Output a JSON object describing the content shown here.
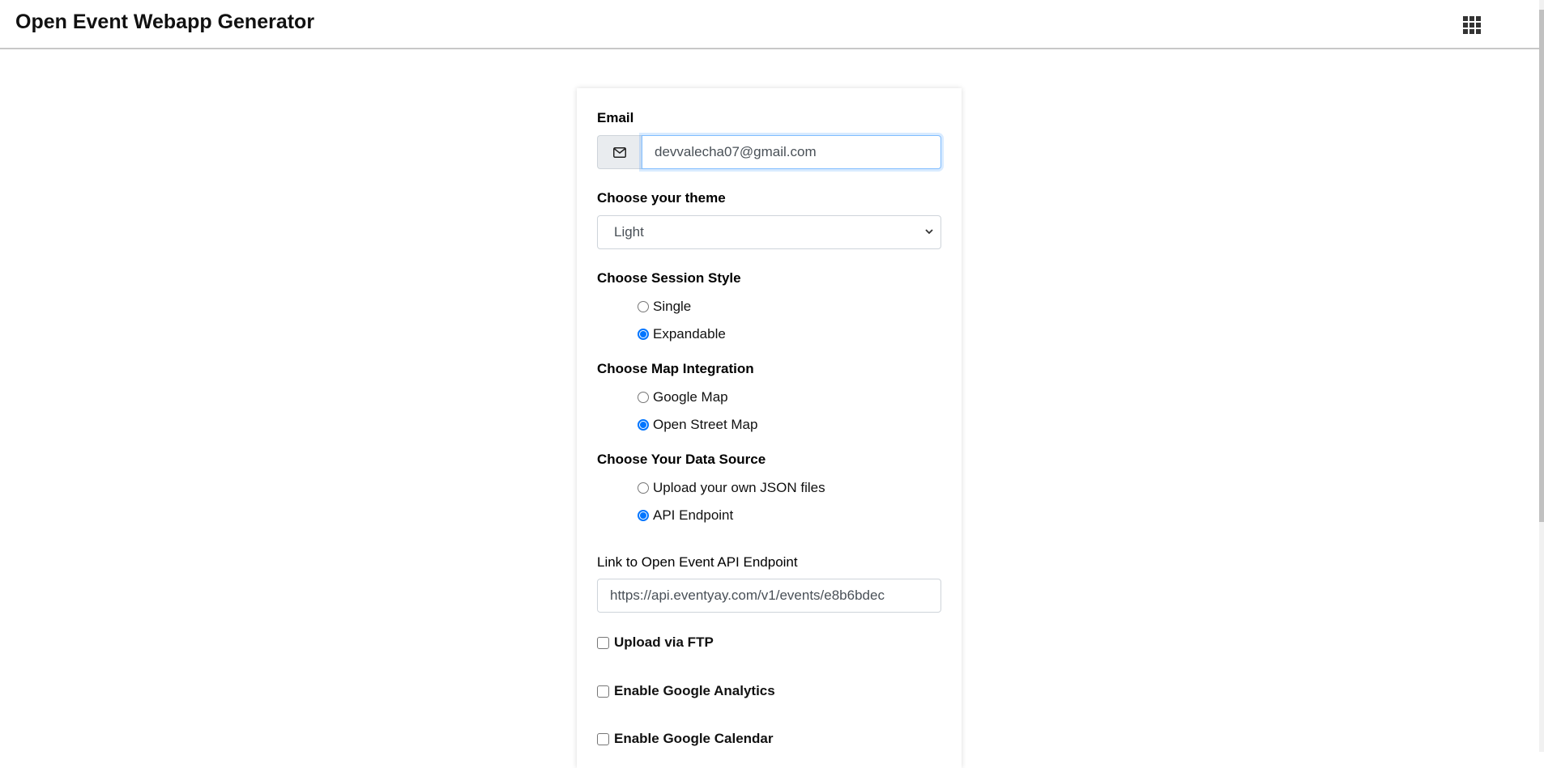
{
  "header": {
    "title": "Open Event Webapp Generator",
    "apps_icon": "grid-apps-icon"
  },
  "form": {
    "email": {
      "label": "Email",
      "icon": "envelope-icon",
      "value": "devvalecha07@gmail.com"
    },
    "theme": {
      "label": "Choose your theme",
      "selected": "Light"
    },
    "session_style": {
      "label": "Choose Session Style",
      "options": [
        {
          "label": "Single",
          "checked": false
        },
        {
          "label": "Expandable",
          "checked": true
        }
      ]
    },
    "map_integration": {
      "label": "Choose Map Integration",
      "options": [
        {
          "label": "Google Map",
          "checked": false
        },
        {
          "label": "Open Street Map",
          "checked": true
        }
      ]
    },
    "data_source": {
      "label": "Choose Your Data Source",
      "options": [
        {
          "label": "Upload your own JSON files",
          "checked": false
        },
        {
          "label": "API Endpoint",
          "checked": true
        }
      ]
    },
    "api_endpoint": {
      "label": "Link to Open Event API Endpoint",
      "value": "https://api.eventyay.com/v1/events/e8b6bdec"
    },
    "checkboxes": [
      {
        "label": "Upload via FTP",
        "checked": false
      },
      {
        "label": "Enable Google Analytics",
        "checked": false
      },
      {
        "label": "Enable Google Calendar",
        "checked": false
      }
    ]
  }
}
